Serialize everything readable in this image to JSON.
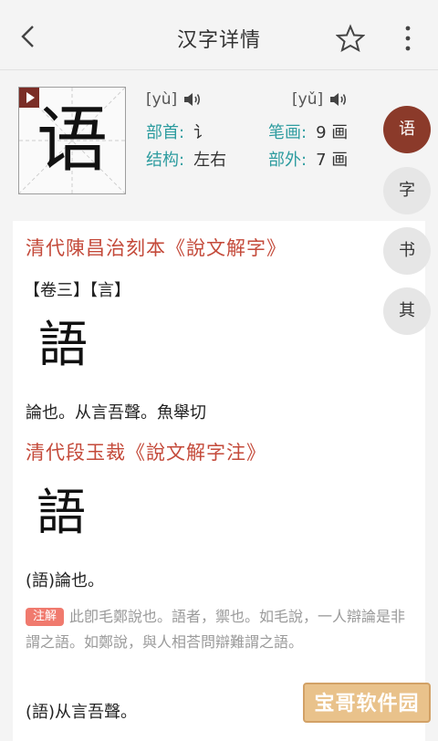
{
  "header": {
    "title": "汉字详情"
  },
  "char": {
    "glyph": "语",
    "pinyin1": "[yù]",
    "pinyin2": "[yǔ]",
    "bushou_label": "部首:",
    "bushou_value": "讠",
    "bihua_label": "笔画:",
    "bihua_value": "9 画",
    "jiegou_label": "结构:",
    "jiegou_value": "左右",
    "buwai_label": "部外:",
    "buwai_value": "7 画"
  },
  "side_tabs": [
    "语",
    "字",
    "书",
    "其"
  ],
  "content": {
    "section1_title": "清代陳昌治刻本《說文解字》",
    "tags": "【卷三】【言】",
    "seal1": "語",
    "line1": "論也。从言吾聲。魚舉切",
    "section2_title": "清代段玉裁《說文解字注》",
    "seal2": "語",
    "line2": "(語)論也。",
    "note_badge": "注解",
    "note_text": "此卽毛鄭說也。語者，禦也。如毛說，一人辯論是非謂之語。如鄭說，與人相荅問辯難謂之語。",
    "line3": "(語)从言吾聲。"
  },
  "watermark": "宝哥软件园",
  "colors": {
    "accent": "#8b3a2a",
    "teal": "#2d9c9f",
    "red_title": "#c44a3a",
    "badge": "#f07a6e"
  }
}
